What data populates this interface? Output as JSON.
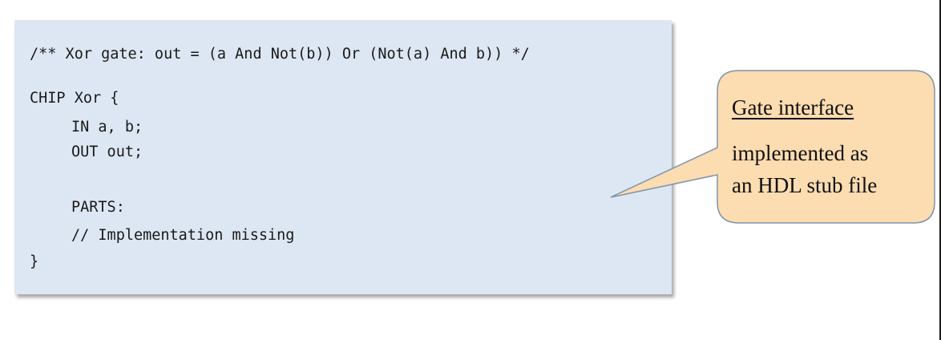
{
  "code": {
    "comment": "/** Xor gate: out = (a And Not(b)) Or (Not(a) And b)) */",
    "chip_decl": "CHIP Xor {",
    "in_line": "IN a, b;",
    "out_line": "OUT out;",
    "parts_line": "PARTS:",
    "missing_comment": "// Implementation missing",
    "closing_brace": "}"
  },
  "callout": {
    "title": "Gate interface",
    "body_line1": "implemented as",
    "body_line2": "an HDL stub file"
  },
  "colors": {
    "code_background": "#dde7f3",
    "callout_fill": "#fcdcb1",
    "callout_stroke": "#7f93ab"
  }
}
